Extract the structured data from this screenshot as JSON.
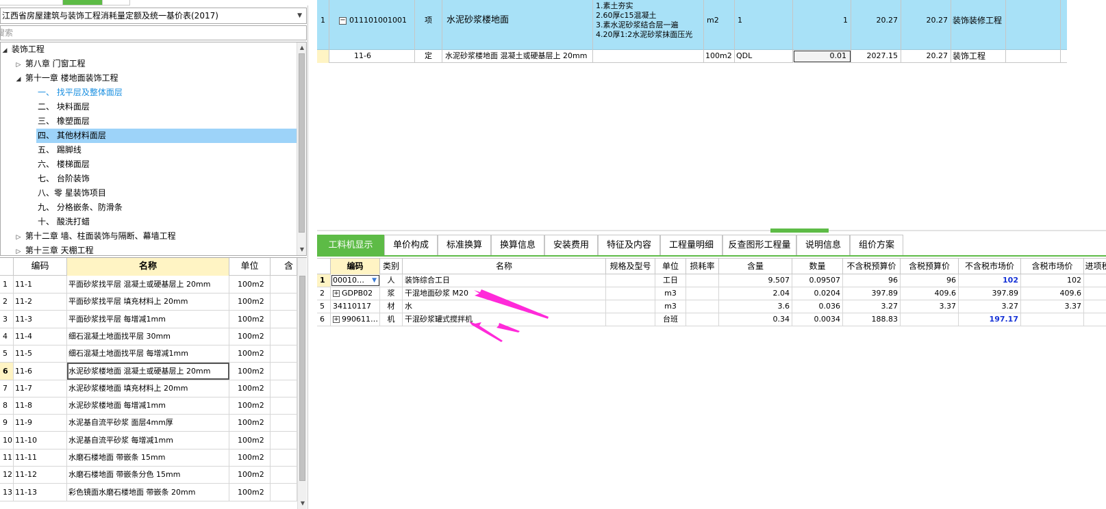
{
  "left": {
    "library": "江西省房屋建筑与装饰工程消耗量定额及统一基价表(2017)",
    "search_placeholder": "搜索",
    "tree": [
      {
        "label": "装饰工程",
        "toggle": "◢",
        "indent": 0
      },
      {
        "label": "第八章 门窗工程",
        "toggle": "▷",
        "indent": 1
      },
      {
        "label": "第十一章 楼地面装饰工程",
        "toggle": "◢",
        "indent": 1
      },
      {
        "label": "一、 找平层及整体面层",
        "toggle": "",
        "indent": 2,
        "state": "highlight"
      },
      {
        "label": "二、 块料面层",
        "toggle": "",
        "indent": 2
      },
      {
        "label": "三、 橡塑面层",
        "toggle": "",
        "indent": 2
      },
      {
        "label": "四、 其他材料面层",
        "toggle": "",
        "indent": 2,
        "state": "selected"
      },
      {
        "label": "五、 踢脚线",
        "toggle": "",
        "indent": 2
      },
      {
        "label": "六、 楼梯面层",
        "toggle": "",
        "indent": 2
      },
      {
        "label": "七、 台阶装饰",
        "toggle": "",
        "indent": 2
      },
      {
        "label": "八、零 星装饰项目",
        "toggle": "",
        "indent": 2
      },
      {
        "label": "九、 分格嵌条、防滑条",
        "toggle": "",
        "indent": 2
      },
      {
        "label": "十、 酸洗打蜡",
        "toggle": "",
        "indent": 2
      },
      {
        "label": "第十二章 墙、柱面装饰与隔断、幕墙工程",
        "toggle": "▷",
        "indent": 1
      },
      {
        "label": "第十三章 天棚工程",
        "toggle": "▷",
        "indent": 1
      }
    ],
    "grid_headers": [
      "编码",
      "名称",
      "单位",
      "含"
    ],
    "grid_rows": [
      {
        "n": "1",
        "code": "11-1",
        "name": "平面砂浆找平层 混凝土或硬基层上 20mm",
        "unit": "100m2"
      },
      {
        "n": "2",
        "code": "11-2",
        "name": "平面砂浆找平层 填充材料上 20mm",
        "unit": "100m2"
      },
      {
        "n": "3",
        "code": "11-3",
        "name": "平面砂浆找平层 每增减1mm",
        "unit": "100m2"
      },
      {
        "n": "4",
        "code": "11-4",
        "name": "细石混凝土地面找平层 30mm",
        "unit": "100m2"
      },
      {
        "n": "5",
        "code": "11-5",
        "name": "细石混凝土地面找平层 每增减1mm",
        "unit": "100m2"
      },
      {
        "n": "6",
        "code": "11-6",
        "name": "水泥砂浆楼地面 混凝土或硬基层上 20mm",
        "unit": "100m2",
        "current": true
      },
      {
        "n": "7",
        "code": "11-7",
        "name": "水泥砂浆楼地面 填充材料上 20mm",
        "unit": "100m2"
      },
      {
        "n": "8",
        "code": "11-8",
        "name": "水泥砂浆楼地面 每增减1mm",
        "unit": "100m2"
      },
      {
        "n": "9",
        "code": "11-9",
        "name": "水泥基自流平砂浆 面层4mm厚",
        "unit": "100m2"
      },
      {
        "n": "10",
        "code": "11-10",
        "name": "水泥基自流平砂浆 每增减1mm",
        "unit": "100m2"
      },
      {
        "n": "11",
        "code": "11-11",
        "name": "水磨石楼地面 带嵌条 15mm",
        "unit": "100m2"
      },
      {
        "n": "12",
        "code": "11-12",
        "name": "水磨石楼地面 带嵌条分色 15mm",
        "unit": "100m2"
      },
      {
        "n": "13",
        "code": "11-13",
        "name": "彩色镜面水磨石楼地面 带嵌条 20mm",
        "unit": "100m2"
      }
    ]
  },
  "top_grid": {
    "row1": {
      "n": "1",
      "code": "011101001001",
      "type": "项",
      "name": "水泥砂浆楼地面",
      "desc": [
        "1.素土夯实",
        "2.60厚c15混凝土",
        "3.素水泥砂浆结合层一遍",
        "4.20厚1:2水泥砂浆抹面压光"
      ],
      "unit": "m2",
      "expr": "1",
      "qty": "1",
      "price": "20.27",
      "total": "20.27",
      "major": "装饰装修工程"
    },
    "row2": {
      "code": "11-6",
      "type": "定",
      "name": "水泥砂浆楼地面 混凝土或硬基层上 20mm",
      "unit": "100m2",
      "expr": "QDL",
      "qty": "0.01",
      "price": "2027.15",
      "total": "20.27",
      "major": "装饰工程"
    }
  },
  "tabs": [
    "工料机显示",
    "单价构成",
    "标准换算",
    "换算信息",
    "安装费用",
    "特征及内容",
    "工程量明细",
    "反查图形工程量",
    "说明信息",
    "组价方案"
  ],
  "material_grid": {
    "headers": [
      "编码",
      "类别",
      "名称",
      "规格及型号",
      "单位",
      "损耗率",
      "含量",
      "数量",
      "不含税预算价",
      "含税预算价",
      "不含税市场价",
      "含税市场价",
      "进项税"
    ],
    "rows": [
      {
        "n": "1",
        "code": "00010…",
        "cat": "人",
        "name": "装饰综合工日",
        "spec": "",
        "unit": "工日",
        "loss": "",
        "content": "9.507",
        "qty": "0.09507",
        "p1": "96",
        "p2": "96",
        "p3": "102",
        "p4": "102",
        "expand": false,
        "current": true,
        "p3blue": true
      },
      {
        "n": "2",
        "code": "GDPB02",
        "cat": "浆",
        "name": "干混地面砂浆 M20",
        "spec": "",
        "unit": "m3",
        "loss": "",
        "content": "2.04",
        "qty": "0.0204",
        "p1": "397.89",
        "p2": "409.6",
        "p3": "397.89",
        "p4": "409.6",
        "expand": true
      },
      {
        "n": "5",
        "code": "34110117",
        "cat": "材",
        "name": "水",
        "spec": "",
        "unit": "m3",
        "loss": "",
        "content": "3.6",
        "qty": "0.036",
        "p1": "3.27",
        "p2": "3.37",
        "p3": "3.27",
        "p4": "3.37",
        "expand": false
      },
      {
        "n": "6",
        "code": "990611…",
        "cat": "机",
        "name": "干混砂浆罐式搅拌机",
        "spec": "",
        "unit": "台班",
        "loss": "",
        "content": "0.34",
        "qty": "0.0034",
        "p1": "188.83",
        "p2": "",
        "p3": "197.17",
        "p4": "",
        "expand": true,
        "p3blue": true
      }
    ]
  },
  "colors": {
    "accent": "#5dbb46",
    "selected_row": "#a8e1f7",
    "header_highlight": "#fff4c4",
    "annotation": "#ff2ad9"
  }
}
